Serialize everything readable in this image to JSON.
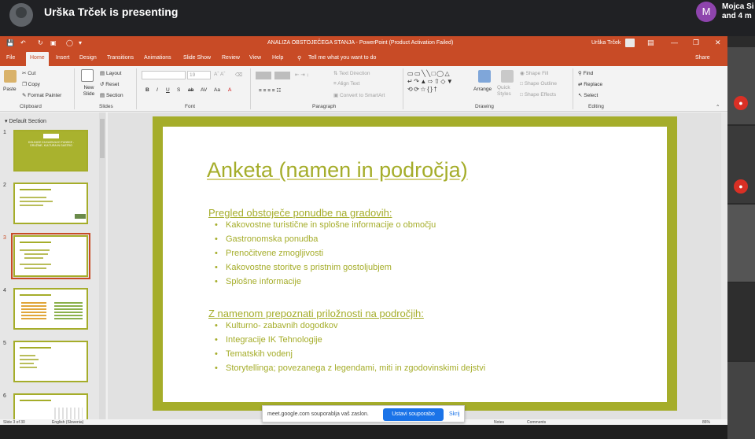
{
  "meet": {
    "presenting_text": "Urška Trček is presenting",
    "avatar_letter": "M",
    "participant_name": "Mojca Si",
    "participant_count": "and 4 m",
    "share_banner_text": "meet.google.com souporablja vaš zaslon.",
    "stop_sharing": "Ustavi souporabo",
    "hide": "Skrij"
  },
  "ppt": {
    "doc_title": "ANALIZA OBSTOJEČEGA STANJA  -  PowerPoint (Product Activation Failed)",
    "user": "Urška Trček",
    "menu": [
      "File",
      "Home",
      "Insert",
      "Design",
      "Transitions",
      "Animations",
      "Slide Show",
      "Review",
      "View",
      "Help"
    ],
    "active_tab": "Home",
    "tell_me": "Tell me what you want to do",
    "share": "Share",
    "ribbon": {
      "paste": "Paste",
      "cut": "Cut",
      "copy": "Copy",
      "format_painter": "Format Painter",
      "clipboard": "Clipboard",
      "new_slide": "New Slide",
      "layout": "Layout",
      "reset": "Reset",
      "section": "Section",
      "slides": "Slides",
      "font_size": "19",
      "font": "Font",
      "text_direction": "Text Direction",
      "align_text": "Align Text",
      "smartart": "Convert to SmartArt",
      "paragraph": "Paragraph",
      "arrange": "Arrange",
      "quick_styles": "Quick Styles",
      "shape_fill": "Shape Fill",
      "shape_outline": "Shape Outline",
      "shape_effects": "Shape Effects",
      "drawing": "Drawing",
      "find": "Find",
      "replace": "Replace",
      "select": "Select",
      "editing": "Editing"
    },
    "section_name": "Default Section",
    "thumb_numbers": [
      "1",
      "2",
      "3",
      "4",
      "5",
      "6"
    ],
    "selected_slide": "3",
    "thumb1_title": "DOLINICE ZA KAZNJUJO FUNSKE - DRUŽINE, KULTURA IN GASTRO",
    "slide": {
      "title": "Anketa (namen in področja)",
      "heading1": "Pregled obstoječe ponudbe na gradovih:",
      "bullets1": [
        "Kakovostne turistične in splošne informacije o območju",
        "Gastronomska ponudba",
        "Prenočitvene zmogljivosti",
        "Kakovostne storitve s pristnim gostoljubjem",
        "Splošne informacije"
      ],
      "heading2": "Z namenom prepoznati priložnosti na področjih:",
      "bullets2": [
        "Kulturno- zabavnih dogodkov",
        "Integracije IK Tehnologije",
        "Tematskih vodenj",
        "Storytellinga; povezanega z legendami, miti in zgodovinskimi dejstvi"
      ]
    },
    "status": {
      "slide_of": "Slide 3 of 30",
      "language": "English (Slovenia)",
      "notes": "Notes",
      "comments": "Comments",
      "zoom": "86%"
    }
  },
  "colors": {
    "accent": "#a5ad2a",
    "titlebar": "#c84b26",
    "meet_blue": "#1a73e8"
  }
}
